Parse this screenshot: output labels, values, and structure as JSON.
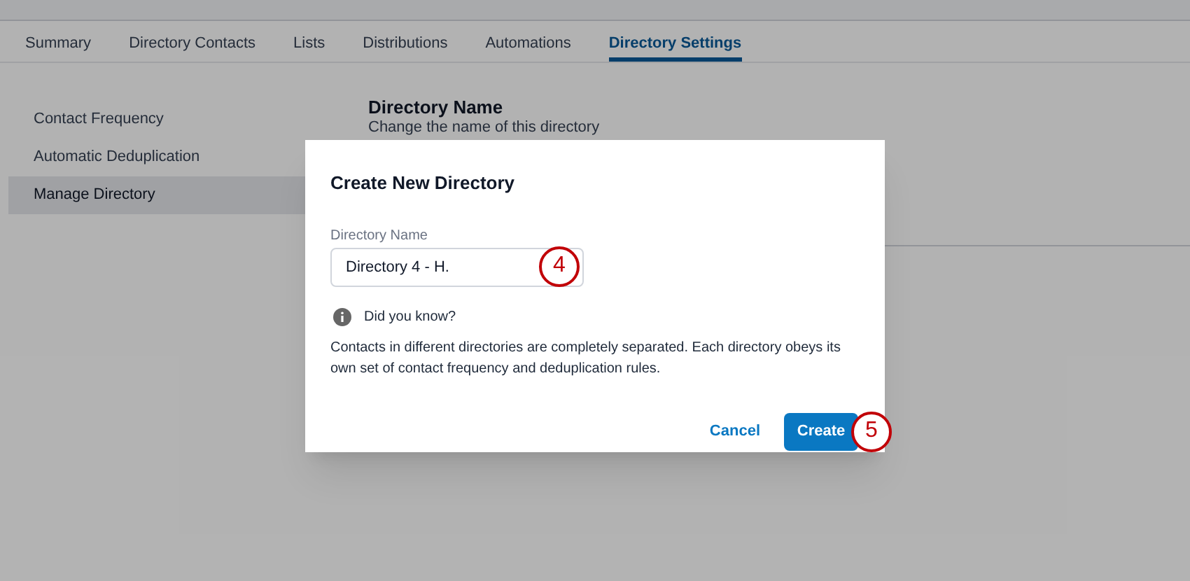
{
  "tabs": [
    {
      "label": "Summary",
      "selected": false
    },
    {
      "label": "Directory Contacts",
      "selected": false
    },
    {
      "label": "Lists",
      "selected": false
    },
    {
      "label": "Distributions",
      "selected": false
    },
    {
      "label": "Automations",
      "selected": false
    },
    {
      "label": "Directory Settings",
      "selected": true
    }
  ],
  "sidebar": {
    "items": [
      {
        "label": "Contact Frequency",
        "selected": false
      },
      {
        "label": "Automatic Deduplication",
        "selected": false
      },
      {
        "label": "Manage Directory",
        "selected": true
      }
    ]
  },
  "content": {
    "heading": "Directory Name",
    "description": "Change the name of this directory"
  },
  "dialog": {
    "title": "Create New Directory",
    "field_label": "Directory Name",
    "field_value": "Directory 4 - H.",
    "field_step": "4",
    "tip_title": "Did you know?",
    "tip_text": "Contacts in different directories are completely separated. Each directory obeys its own set of contact frequency and deduplication rules.",
    "cancel": "Cancel",
    "create": "Create",
    "create_step": "5"
  }
}
